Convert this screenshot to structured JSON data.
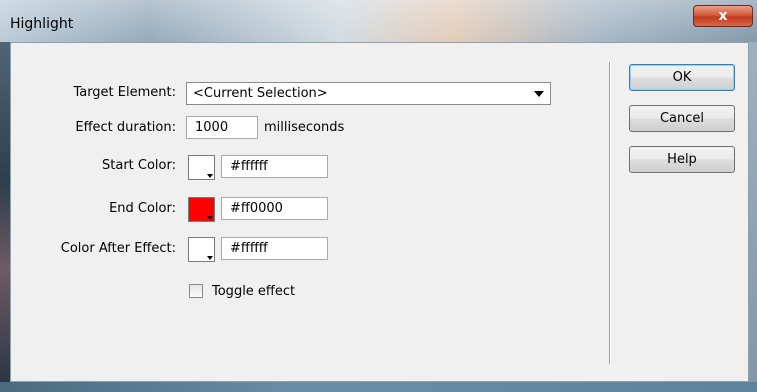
{
  "window": {
    "title": "Highlight",
    "close_glyph": "x"
  },
  "form": {
    "target_element_label": "Target Element:",
    "target_element_value": "<Current Selection>",
    "effect_duration_label": "Effect duration:",
    "effect_duration_value": "1000",
    "effect_duration_unit": "milliseconds",
    "start_color_label": "Start Color:",
    "start_color_value": "#ffffff",
    "end_color_label": "End Color:",
    "end_color_value": "#ff0000",
    "end_color_text": "#ff0000",
    "after_color_label": "Color After Effect:",
    "after_color_value": "#ffffff",
    "toggle_effect_label": "Toggle effect",
    "toggle_effect_checked": false
  },
  "buttons": {
    "ok": "OK",
    "cancel": "Cancel",
    "help": "Help"
  },
  "icons": {
    "close": "close-icon",
    "dropdown": "chevron-down-icon",
    "swatch_arrow": "caret-down-icon"
  }
}
